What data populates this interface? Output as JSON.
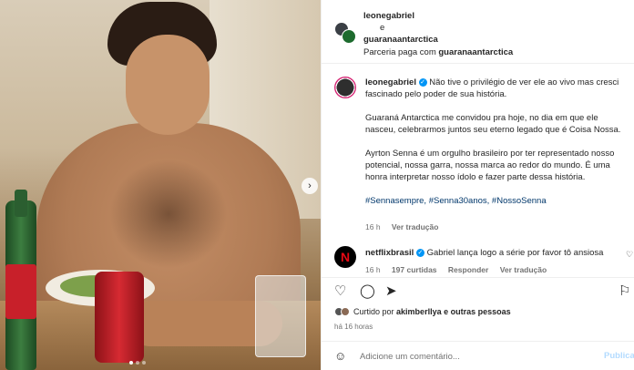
{
  "post": {
    "carousel_next": "›",
    "header": {
      "user1": "leonegabriel",
      "conjunction": "e",
      "user2": "guaranaantarctica",
      "paid_prefix": "Parceria paga com",
      "paid_brand": "guaranaantarctica"
    },
    "caption": {
      "user": "leonegabriel",
      "verified": "✓",
      "p1": "Não tive o privilégio de ver ele ao vivo mas cresci fascinado pelo poder de sua história.",
      "p2": "Guaraná Antarctica me convidou pra hoje, no dia em que ele nasceu, celebrarmos juntos seu eterno legado que é Coisa Nossa.",
      "p3": "Ayrton Senna é um orgulho brasileiro por ter representado nosso potencial, nossa garra, nossa marca ao redor do mundo. É uma honra interpretar nosso ídolo e fazer parte dessa história.",
      "hashtags": [
        "#Sennasempre,",
        "#Senna30anos,",
        "#NossoSenna"
      ],
      "time": "16 h",
      "translate": "Ver tradução"
    },
    "comment": {
      "avatar_letter": "N",
      "user": "netflixbrasil",
      "text": "Gabriel lança logo a série por favor tô ansiosa",
      "time": "16 h",
      "likes": "197 curtidas",
      "reply": "Responder",
      "translate": "Ver tradução"
    },
    "actions": {
      "like_icon": "♡",
      "comment_icon": "◯",
      "share_icon": "➤",
      "save_icon": "⚐"
    },
    "likes": {
      "prefix": "Curtido por",
      "user": "akimberllya",
      "suffix": "e outras pessoas"
    },
    "time_ago": "há 16 horas",
    "add_comment": {
      "emoji_icon": "☺",
      "placeholder": "Adicione um comentário...",
      "post_label": "Publicar"
    }
  }
}
